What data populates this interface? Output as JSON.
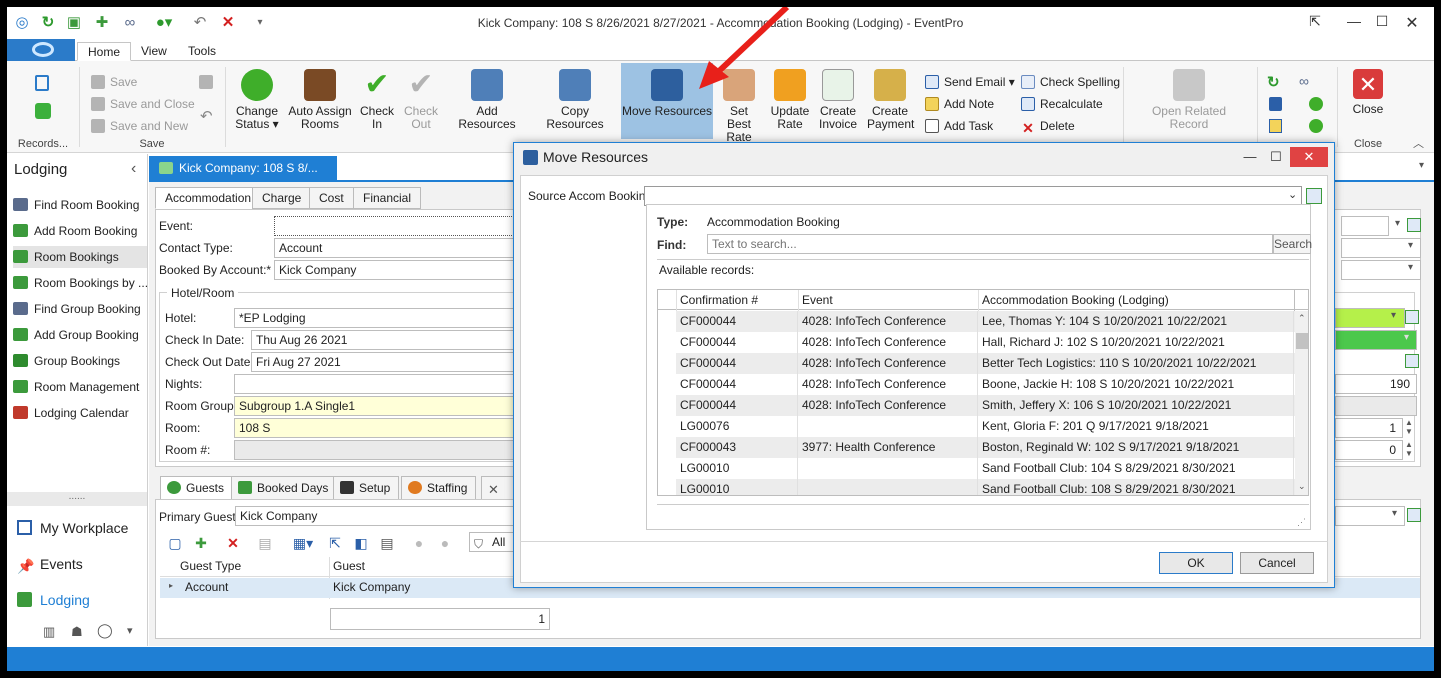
{
  "window": {
    "title": "Kick Company:  108 S 8/26/2021 8/27/2021  - Accommodation Booking (Lodging) - EventPro"
  },
  "ribbon": {
    "tabs": [
      "Home",
      "View",
      "Tools"
    ],
    "active_tab": "Home",
    "records_group": {
      "label": "Records..."
    },
    "save_group": {
      "label": "Save",
      "save": "Save",
      "save_close": "Save and Close",
      "save_new": "Save and New"
    },
    "buttons": {
      "change_status": [
        "Change",
        "Status ▾"
      ],
      "auto_assign": [
        "Auto Assign",
        "Rooms"
      ],
      "check_in": [
        "Check",
        "In"
      ],
      "check_out": [
        "Check",
        "Out"
      ],
      "add_resources": "Add Resources",
      "copy_resources": "Copy Resources",
      "move_resources": "Move Resources",
      "set_best_rate": [
        "Set Best",
        "Rate"
      ],
      "update_rate": [
        "Update",
        "Rate"
      ],
      "create_invoice": [
        "Create",
        "Invoice"
      ],
      "create_payment": [
        "Create",
        "Payment"
      ],
      "send_email": "Send Email ▾",
      "add_note": "Add Note",
      "add_task": "Add Task",
      "check_spelling": "Check Spelling",
      "recalculate": "Recalculate",
      "delete": "Delete",
      "open_related": [
        "Open Related",
        "Record"
      ],
      "close": "Close"
    },
    "close_group": {
      "label": "Close"
    }
  },
  "leftnav": {
    "title": "Lodging",
    "items": [
      {
        "label": "Find Room Booking",
        "color": "#5a6b8c"
      },
      {
        "label": "Add Room Booking",
        "color": "#3c9a3c"
      },
      {
        "label": "Room Bookings",
        "color": "#3c9a3c"
      },
      {
        "label": "Room Bookings by ...",
        "color": "#3c9a3c"
      },
      {
        "label": "Find Group Booking",
        "color": "#5a6b8c"
      },
      {
        "label": "Add Group Booking",
        "color": "#3c9a3c"
      },
      {
        "label": "Group Bookings",
        "color": "#2e8b2e"
      },
      {
        "label": "Room Management",
        "color": "#3c9a3c"
      },
      {
        "label": "Lodging Calendar",
        "color": "#c0392b"
      }
    ],
    "dots": "......",
    "big": [
      "My Workplace",
      "Events",
      "Lodging"
    ]
  },
  "doc": {
    "tab_label": "Kick Company:  108 S 8/...",
    "form_tabs": [
      "Accommodation",
      "Charge",
      "Cost",
      "Financial"
    ],
    "fields": {
      "event_label": "Event:",
      "contact_type_label": "Contact Type:",
      "contact_type": "Account",
      "booked_by_label": "Booked By Account:*",
      "booked_by": "Kick Company",
      "hotel_room_label": "Hotel/Room",
      "hotel_label": "Hotel:",
      "hotel": "*EP Lodging",
      "check_in_label": "Check In Date:",
      "check_in": "Thu Aug 26 2021",
      "check_out_label": "Check Out Date:",
      "check_out": "Fri Aug 27 2021",
      "nights_label": "Nights:",
      "room_group_label": "Room Group:",
      "room_group": "Subgroup 1.A Single1",
      "room_label": "Room:",
      "room": "108 S",
      "room_num_label": "Room #:"
    },
    "right_values": {
      "v190": "190",
      "v1": "1",
      "v0": "0"
    },
    "bottom_tabs": [
      "Guests",
      "Booked Days",
      "Setup",
      "Staffing"
    ],
    "primary_guest_label": "Primary Guest:",
    "primary_guest": "Kick Company",
    "filter_label": "All",
    "guest_grid": {
      "headers": [
        "Guest Type",
        "Guest"
      ],
      "row": [
        "Account",
        "Kick Company"
      ],
      "count": "1"
    }
  },
  "dialog": {
    "title": "Move Resources",
    "source_label": "Source Accom Booking:",
    "type_label": "Type:",
    "type_value": "Accommodation Booking",
    "find_label": "Find:",
    "find_placeholder": "Text to search...",
    "search_button": "Search",
    "available_label": "Available records:",
    "grid_headers": [
      "Confirmation #",
      "Event",
      "Accommodation Booking (Lodging)"
    ],
    "grid_rows": [
      [
        "CF000044",
        "4028: InfoTech Conference",
        "Lee, Thomas Y: 104 S 10/20/2021 10/22/2021"
      ],
      [
        "CF000044",
        "4028: InfoTech Conference",
        "Hall, Richard J: 102 S 10/20/2021 10/22/2021"
      ],
      [
        "CF000044",
        "4028: InfoTech Conference",
        "Better Tech Logistics: 110 S 10/20/2021 10/22/2021"
      ],
      [
        "CF000044",
        "4028: InfoTech Conference",
        "Boone, Jackie H: 108 S 10/20/2021 10/22/2021"
      ],
      [
        "CF000044",
        "4028: InfoTech Conference",
        "Smith, Jeffery X: 106 S 10/20/2021 10/22/2021"
      ],
      [
        "LG00076",
        "",
        "Kent, Gloria F: 201 Q 9/17/2021 9/18/2021"
      ],
      [
        "CF000043",
        "3977: Health Conference",
        "Boston, Reginald W: 102 S 9/17/2021 9/18/2021"
      ],
      [
        "LG00010",
        "",
        "Sand Football Club: 104 S 8/29/2021 8/30/2021"
      ],
      [
        "LG00010",
        "",
        "Sand Football Club: 108 S 8/29/2021 8/30/2021"
      ]
    ],
    "ok": "OK",
    "cancel": "Cancel"
  },
  "colors": {
    "accent": "#1f7fd4",
    "selected_ribbon": "#9dc2e3",
    "arrow": "#e8201a"
  }
}
